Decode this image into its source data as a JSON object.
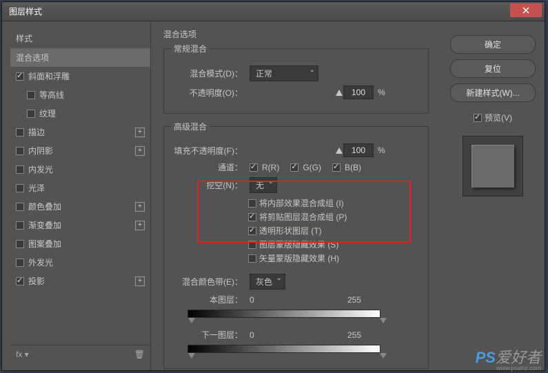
{
  "window": {
    "title": "图层样式"
  },
  "sidebar": {
    "header": "样式",
    "selected_group": "混合选项",
    "items": [
      {
        "label": "斜面和浮雕",
        "checked": true,
        "addable": false
      },
      {
        "label": "等高线",
        "checked": false,
        "indent": true
      },
      {
        "label": "纹理",
        "checked": false,
        "indent": true
      },
      {
        "label": "描边",
        "checked": false,
        "addable": true
      },
      {
        "label": "内阴影",
        "checked": false,
        "addable": true
      },
      {
        "label": "内发光",
        "checked": false
      },
      {
        "label": "光泽",
        "checked": false
      },
      {
        "label": "颜色叠加",
        "checked": false,
        "addable": true
      },
      {
        "label": "渐变叠加",
        "checked": false,
        "addable": true
      },
      {
        "label": "图案叠加",
        "checked": false
      },
      {
        "label": "外发光",
        "checked": false
      },
      {
        "label": "投影",
        "checked": true,
        "addable": true
      }
    ]
  },
  "main": {
    "title": "混合选项",
    "normal_blend": {
      "legend": "常规混合",
      "mode_label": "混合模式(D)：",
      "mode_value": "正常",
      "opacity_label": "不透明度(O)：",
      "opacity_value": "100",
      "opacity_unit": "%"
    },
    "advanced_blend": {
      "legend": "高级混合",
      "fill_label": "填充不透明度(F)：",
      "fill_value": "100",
      "fill_unit": "%",
      "channels_label": "通道：",
      "channel_r": "R(R)",
      "channel_g": "G(G)",
      "channel_b": "B(B)",
      "knockout_label": "挖空(N)：",
      "knockout_value": "无",
      "opts": [
        {
          "label": "将内部效果混合成组 (I)",
          "checked": false
        },
        {
          "label": "将剪贴图层混合成组 (P)",
          "checked": true
        },
        {
          "label": "透明形状图层 (T)",
          "checked": true
        },
        {
          "label": "图层蒙版隐藏效果 (S)",
          "checked": false
        },
        {
          "label": "矢量蒙版隐藏效果 (H)",
          "checked": false
        }
      ],
      "blend_if_label": "混合颜色带(E)：",
      "blend_if_value": "灰色",
      "this_layer": "本图层：",
      "underlying": "下一图层：",
      "range_low": "0",
      "range_high": "255"
    }
  },
  "buttons": {
    "ok": "确定",
    "cancel": "复位",
    "new_style": "新建样式(W)...",
    "preview": "预览(V)"
  },
  "watermark": {
    "ps": "PS",
    "text": "爱好者",
    "url": "www.psahz.com"
  }
}
